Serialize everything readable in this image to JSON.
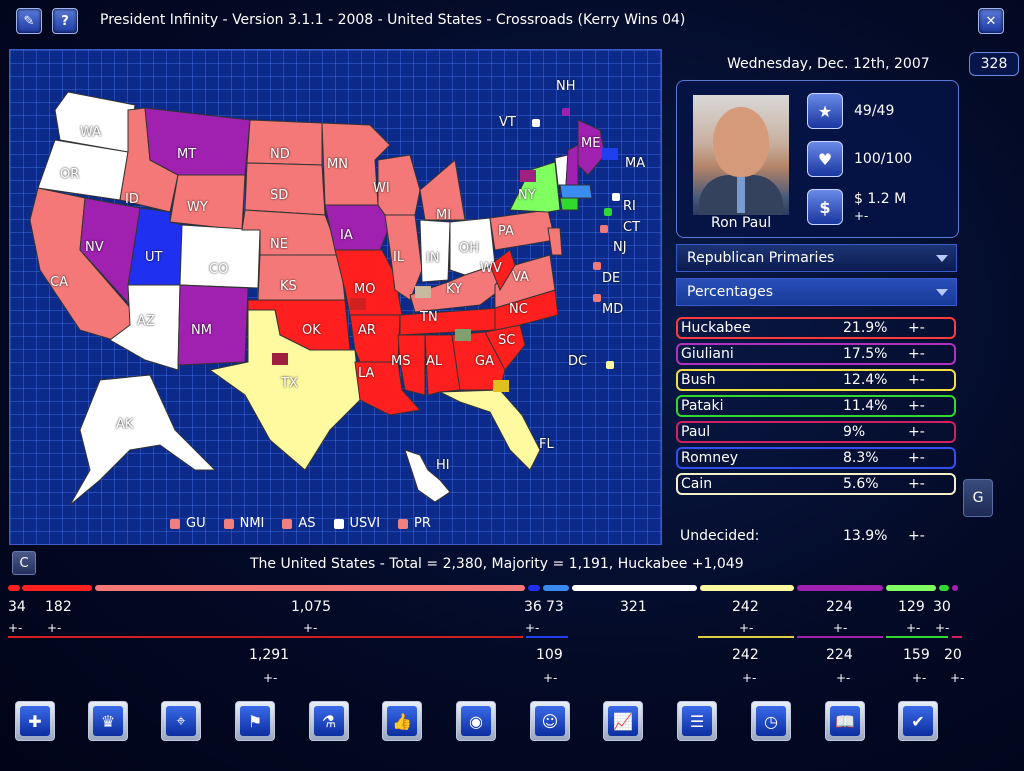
{
  "window": {
    "title": "President Infinity - Version 3.1.1 - 2008 - United States - Crossroads (Kerry Wins 04)",
    "close_label": "✕",
    "left_buttons": [
      "✎",
      "?"
    ]
  },
  "header": {
    "date": "Wednesday, Dec. 12th, 2007",
    "counter": "328"
  },
  "candidate": {
    "name": "Ron Paul",
    "stats": [
      {
        "icon": "star-icon",
        "glyph": "★",
        "value": "49/49"
      },
      {
        "icon": "heart-icon",
        "glyph": "♥",
        "value": "100/100"
      },
      {
        "icon": "dollar-icon",
        "glyph": "$",
        "value": "$ 1.2 M",
        "sub": "+-"
      }
    ]
  },
  "dropdowns": {
    "race": "Republican Primaries",
    "mode": "Percentages"
  },
  "polls": [
    {
      "name": "Huckabee",
      "pct": "21.9%",
      "pm": "+-",
      "color": "#ff3b3b"
    },
    {
      "name": "Giuliani",
      "pct": "17.5%",
      "pm": "+-",
      "color": "#b030c0"
    },
    {
      "name": "Bush",
      "pct": "12.4%",
      "pm": "+-",
      "color": "#f0e040"
    },
    {
      "name": "Pataki",
      "pct": "11.4%",
      "pm": "+-",
      "color": "#30d830"
    },
    {
      "name": "Paul",
      "pct": "9%",
      "pm": "+-",
      "color": "#d02060"
    },
    {
      "name": "Romney",
      "pct": "8.3%",
      "pm": "+-",
      "color": "#3050f0"
    },
    {
      "name": "Cain",
      "pct": "5.6%",
      "pm": "+-",
      "color": "#f4f0c8"
    }
  ],
  "undecided": {
    "label": "Undecided:",
    "pct": "13.9%",
    "pm": "+-"
  },
  "side_buttons": {
    "g": "G",
    "c": "C"
  },
  "summary": "The United States - Total = 2,380, Majority = 1,191, Huckabee +1,049",
  "delegates_top": [
    {
      "num": "34",
      "pm": "+-"
    },
    {
      "num": "182",
      "pm": "+-"
    },
    {
      "num": "1,075",
      "pm": "+-"
    },
    {
      "num": "36",
      "pm": "+-"
    },
    {
      "num": "73",
      "pm": ""
    },
    {
      "num": "321",
      "pm": ""
    },
    {
      "num": "242",
      "pm": "+-"
    },
    {
      "num": "224",
      "pm": "+-"
    },
    {
      "num": "129",
      "pm": "+-"
    },
    {
      "num": "30",
      "pm": "+-"
    }
  ],
  "delegates_bottom": [
    {
      "num": "1,291",
      "pm": "+-"
    },
    {
      "num": "109",
      "pm": "+-"
    },
    {
      "num": "242",
      "pm": "+-"
    },
    {
      "num": "224",
      "pm": "+-"
    },
    {
      "num": "159",
      "pm": "+-"
    },
    {
      "num": "20",
      "pm": "+-"
    }
  ],
  "map": {
    "states": [
      "WA",
      "OR",
      "CA",
      "NV",
      "ID",
      "MT",
      "WY",
      "UT",
      "CO",
      "AZ",
      "NM",
      "ND",
      "SD",
      "NE",
      "KS",
      "OK",
      "TX",
      "MN",
      "IA",
      "MO",
      "AR",
      "LA",
      "WI",
      "IL",
      "MI",
      "IN",
      "OH",
      "KY",
      "TN",
      "MS",
      "AL",
      "GA",
      "FL",
      "SC",
      "NC",
      "VA",
      "WV",
      "PA",
      "NY",
      "VT",
      "NH",
      "ME",
      "MA",
      "RI",
      "CT",
      "NJ",
      "DE",
      "MD",
      "DC",
      "AK",
      "HI"
    ],
    "territories": [
      {
        "label": "GU",
        "color": "#f08080"
      },
      {
        "label": "NMI",
        "color": "#f08080"
      },
      {
        "label": "AS",
        "color": "#f08080"
      },
      {
        "label": "USVI",
        "color": "#ffffff"
      },
      {
        "label": "PR",
        "color": "#f08080"
      }
    ]
  },
  "toolbar": [
    "puzzle-icon",
    "crown-icon",
    "satellite-icon",
    "flag-icon",
    "flask-icon",
    "thumbs-up-icon",
    "podcast-icon",
    "person-icon",
    "chart-icon",
    "document-icon",
    "clock-icon",
    "reader-icon",
    "check-icon"
  ],
  "toolbar_glyphs": [
    "✚",
    "♛",
    "⌖",
    "⚑",
    "⚗",
    "👍",
    "◉",
    "☺",
    "📈",
    "☰",
    "◷",
    "📖",
    "✔"
  ],
  "colors": {
    "huckabee": "#ff1f1f",
    "huckabee_light": "#f47878",
    "giuliani": "#a020b0",
    "bush": "#fffaa0",
    "pataki": "#80ff60",
    "romney": "#2030f0",
    "undecided": "#ffffff"
  }
}
